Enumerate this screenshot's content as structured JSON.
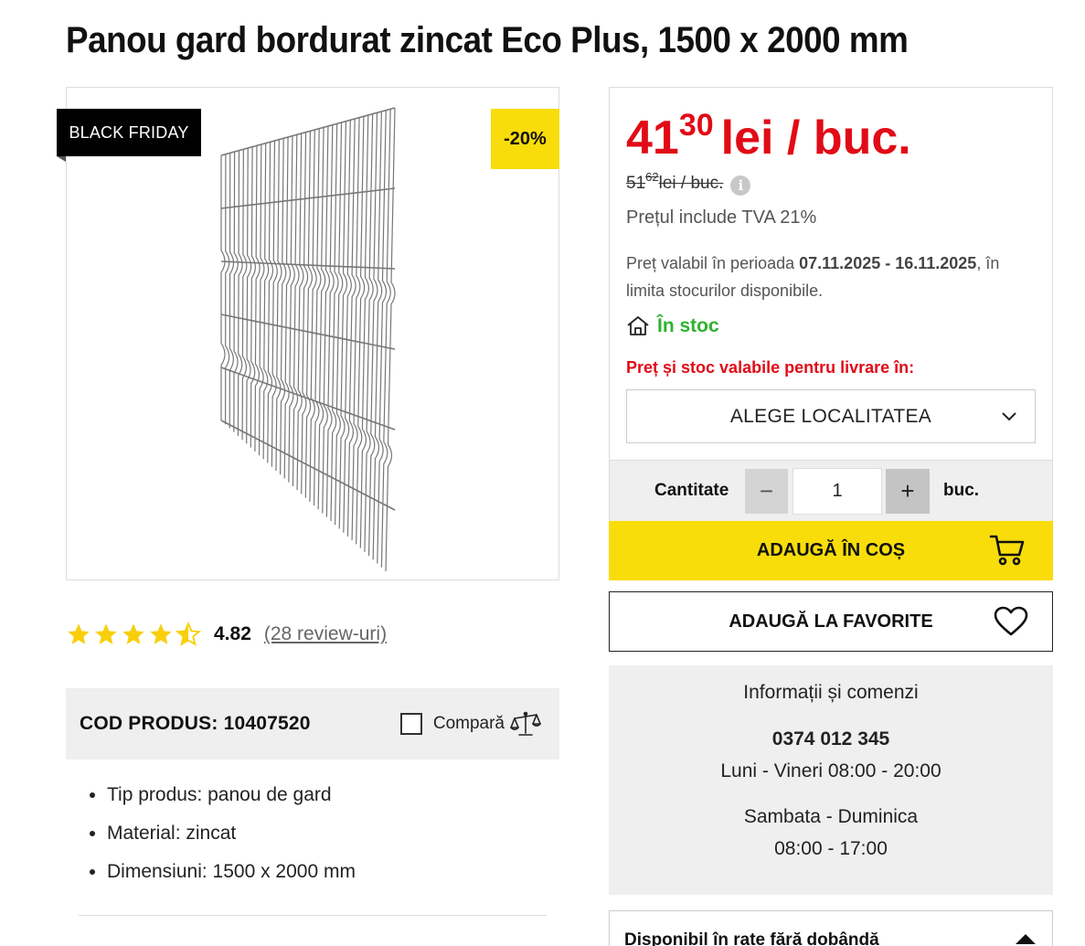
{
  "product": {
    "title": "Panou gard bordurat zincat Eco Plus, 1500 x 2000 mm",
    "badge_left": "BLACK FRIDAY",
    "badge_discount": "-20%",
    "image_icon": "fence-panel-image",
    "rating": {
      "stars": 4.82,
      "value": "4.82",
      "reviews": "(28 review-uri)"
    },
    "code": "COD PRODUS: 10407520",
    "compare_label": "Compară",
    "features": [
      "Tip produs: panou de gard",
      "Material: zincat",
      "Dimensiuni: 1500 x 2000 mm"
    ]
  },
  "price": {
    "integer": "41",
    "decimals": "30",
    "unit": "lei / buc.",
    "old_integer": "51",
    "old_decimals": "62",
    "old_unit": " lei / buc.",
    "vat": "Prețul include TVA 21%",
    "validity_prefix": "Preț valabil în perioada ",
    "validity_dates": "07.11.2025 - 16.11.2025",
    "validity_suffix": ", în limita stocurilor disponibile.",
    "stock": "În stoc",
    "delivery_note": "Preț și stoc valabile pentru livrare în:",
    "locality": "ALEGE LOCALITATEA"
  },
  "quantity": {
    "label": "Cantitate",
    "minus": "−",
    "value": "1",
    "plus": "+",
    "unit": "buc."
  },
  "actions": {
    "add_to_cart": "ADAUGĂ ÎN COȘ",
    "add_to_favorites": "ADAUGĂ LA FAVORITE"
  },
  "contact": {
    "title": "Informații și comenzi",
    "phone": "0374 012 345",
    "weekdays": "Luni - Vineri 08:00 - 20:00",
    "weekend": "Sambata - Duminica",
    "weekend_hours": "08:00 - 17:00"
  },
  "installments": {
    "label": "Disponibil în rate fără dobândă"
  },
  "colors": {
    "accent_yellow": "#f8dd0a",
    "price_red": "#e10b17",
    "stock_green": "#2db22d",
    "panel_gray": "#efefef"
  }
}
